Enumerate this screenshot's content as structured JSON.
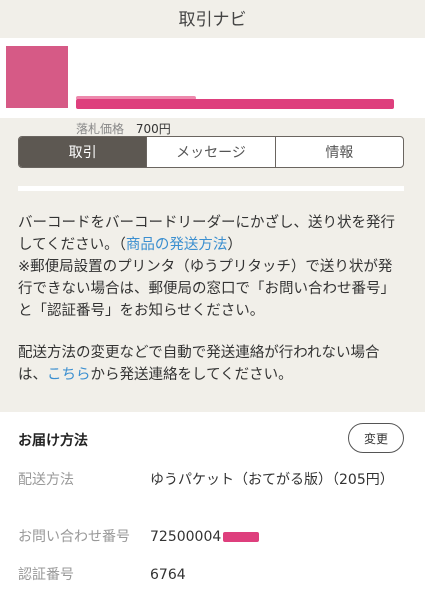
{
  "header": {
    "title": "取引ナビ"
  },
  "item": {
    "price_label": "落札価格",
    "price_value": "700円"
  },
  "tabs": [
    {
      "label": "取引",
      "active": true
    },
    {
      "label": "メッセージ",
      "active": false
    },
    {
      "label": "情報",
      "active": false
    }
  ],
  "instructions": {
    "p1_pre": "バーコードをバーコードリーダーにかざし、送り状を発行してください。（",
    "p1_link": "商品の発送方法",
    "p1_post": "）",
    "p1_note": "※郵便局設置のプリンタ（ゆうプリタッチ）で送り状が発行できない場合は、郵便局の窓口で「お問い合わせ番号」と「認証番号」をお知らせください。",
    "p2_pre": "配送方法の変更などで自動で発送連絡が行われない場合は、",
    "p2_link": "こちら",
    "p2_post": "から発送連絡をしてください。"
  },
  "delivery": {
    "title": "お届け方法",
    "change_button": "変更",
    "method_label": "配送方法",
    "method_value": "ゆうパケット（おてがる版）（205円）",
    "inquiry_label": "お問い合わせ番号",
    "inquiry_value": "72500004",
    "auth_label": "認証番号",
    "auth_value": "6764"
  },
  "colors": {
    "background": "#f1efe9",
    "active_tab": "#5d5852",
    "link": "#3b8fd0",
    "redaction": "#de3f7d"
  }
}
